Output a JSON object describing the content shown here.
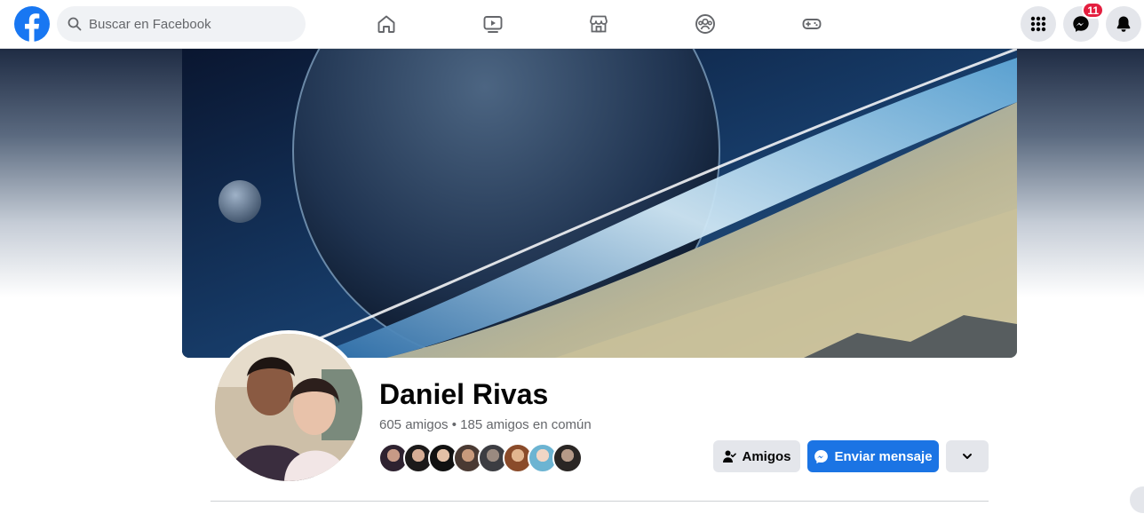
{
  "search": {
    "placeholder": "Buscar en Facebook"
  },
  "nav": {
    "tabs": [
      {
        "name": "home",
        "icon": "home-icon"
      },
      {
        "name": "watch",
        "icon": "video-icon"
      },
      {
        "name": "marketplace",
        "icon": "store-icon"
      },
      {
        "name": "groups",
        "icon": "groups-icon"
      },
      {
        "name": "gaming",
        "icon": "gamepad-icon"
      }
    ]
  },
  "header_actions": {
    "menu_icon": "grid-menu-icon",
    "messenger_icon": "messenger-icon",
    "messenger_badge": "11",
    "notifications_icon": "bell-icon"
  },
  "profile": {
    "name": "Daniel Rivas",
    "friends_summary": "605 amigos • 185 amigos en común",
    "mutual_friend_avatars": 8
  },
  "actions": {
    "friends_label": "Amigos",
    "message_label": "Enviar mensaje",
    "more_icon": "chevron-down-icon"
  },
  "colors": {
    "brand": "#1877f2",
    "primary_button": "#1b74e4",
    "secondary_button": "#e4e6eb",
    "badge": "#e41e3f"
  }
}
